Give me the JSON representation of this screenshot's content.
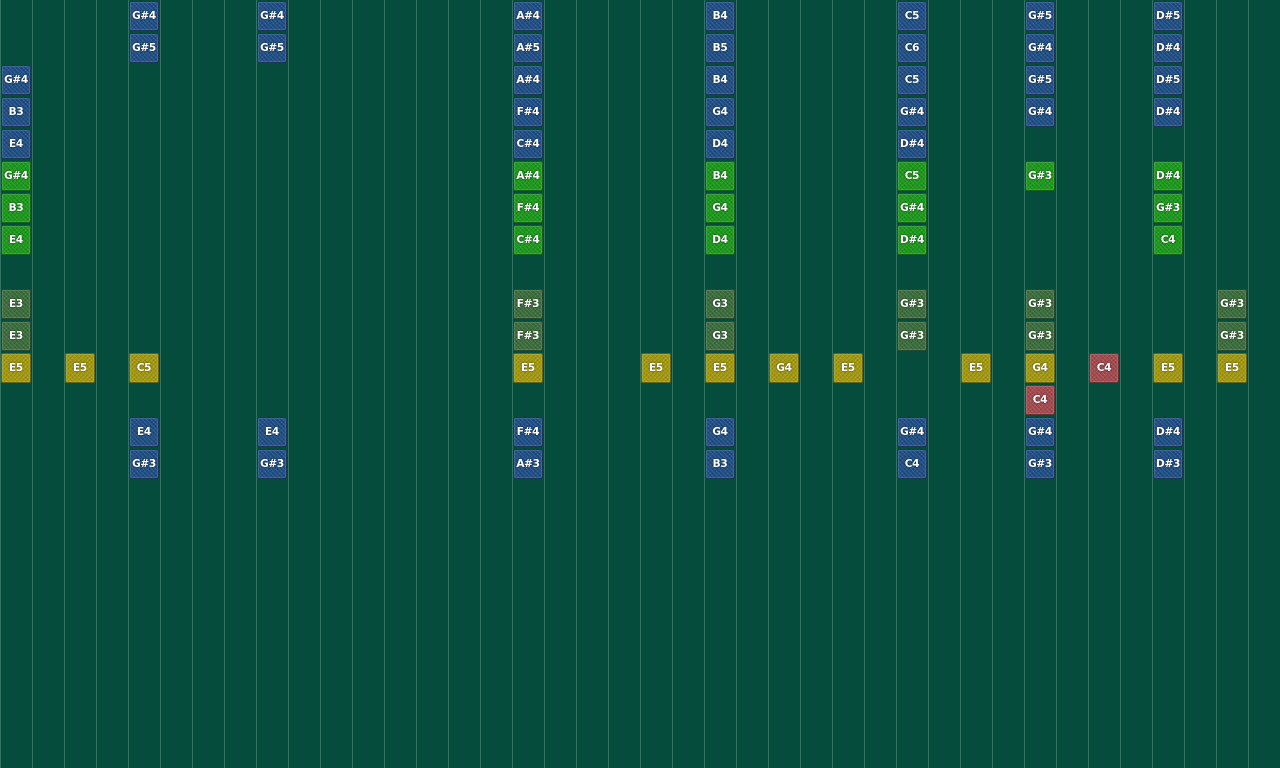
{
  "theme": {
    "background": "#064c3c",
    "grid_line": "#5a9682",
    "colors": {
      "blue": "#1f4f86",
      "green": "#1b9a1b",
      "olive": "#3b6d3c",
      "yellow": "#a49a10",
      "red": "#a54a4e"
    }
  },
  "grid": {
    "columns": 40,
    "rows": 24
  },
  "notes": [
    {
      "col": 4,
      "row": 0,
      "label": "G#4",
      "color": "blue"
    },
    {
      "col": 8,
      "row": 0,
      "label": "G#4",
      "color": "blue"
    },
    {
      "col": 16,
      "row": 0,
      "label": "A#4",
      "color": "blue"
    },
    {
      "col": 22,
      "row": 0,
      "label": "B4",
      "color": "blue"
    },
    {
      "col": 28,
      "row": 0,
      "label": "C5",
      "color": "blue"
    },
    {
      "col": 32,
      "row": 0,
      "label": "G#5",
      "color": "blue"
    },
    {
      "col": 36,
      "row": 0,
      "label": "D#5",
      "color": "blue"
    },
    {
      "col": 4,
      "row": 1,
      "label": "G#5",
      "color": "blue"
    },
    {
      "col": 8,
      "row": 1,
      "label": "G#5",
      "color": "blue"
    },
    {
      "col": 16,
      "row": 1,
      "label": "A#5",
      "color": "blue"
    },
    {
      "col": 22,
      "row": 1,
      "label": "B5",
      "color": "blue"
    },
    {
      "col": 28,
      "row": 1,
      "label": "C6",
      "color": "blue"
    },
    {
      "col": 32,
      "row": 1,
      "label": "G#4",
      "color": "blue"
    },
    {
      "col": 36,
      "row": 1,
      "label": "D#4",
      "color": "blue"
    },
    {
      "col": 0,
      "row": 2,
      "label": "G#4",
      "color": "blue"
    },
    {
      "col": 16,
      "row": 2,
      "label": "A#4",
      "color": "blue"
    },
    {
      "col": 22,
      "row": 2,
      "label": "B4",
      "color": "blue"
    },
    {
      "col": 28,
      "row": 2,
      "label": "C5",
      "color": "blue"
    },
    {
      "col": 32,
      "row": 2,
      "label": "G#5",
      "color": "blue"
    },
    {
      "col": 36,
      "row": 2,
      "label": "D#5",
      "color": "blue"
    },
    {
      "col": 0,
      "row": 3,
      "label": "B3",
      "color": "blue"
    },
    {
      "col": 16,
      "row": 3,
      "label": "F#4",
      "color": "blue"
    },
    {
      "col": 22,
      "row": 3,
      "label": "G4",
      "color": "blue"
    },
    {
      "col": 28,
      "row": 3,
      "label": "G#4",
      "color": "blue"
    },
    {
      "col": 32,
      "row": 3,
      "label": "G#4",
      "color": "blue"
    },
    {
      "col": 36,
      "row": 3,
      "label": "D#4",
      "color": "blue"
    },
    {
      "col": 0,
      "row": 4,
      "label": "E4",
      "color": "blue"
    },
    {
      "col": 16,
      "row": 4,
      "label": "C#4",
      "color": "blue"
    },
    {
      "col": 22,
      "row": 4,
      "label": "D4",
      "color": "blue"
    },
    {
      "col": 28,
      "row": 4,
      "label": "D#4",
      "color": "blue"
    },
    {
      "col": 0,
      "row": 5,
      "label": "G#4",
      "color": "green"
    },
    {
      "col": 16,
      "row": 5,
      "label": "A#4",
      "color": "green"
    },
    {
      "col": 22,
      "row": 5,
      "label": "B4",
      "color": "green"
    },
    {
      "col": 28,
      "row": 5,
      "label": "C5",
      "color": "green"
    },
    {
      "col": 32,
      "row": 5,
      "label": "G#3",
      "color": "green"
    },
    {
      "col": 36,
      "row": 5,
      "label": "D#4",
      "color": "green"
    },
    {
      "col": 0,
      "row": 6,
      "label": "B3",
      "color": "green"
    },
    {
      "col": 16,
      "row": 6,
      "label": "F#4",
      "color": "green"
    },
    {
      "col": 22,
      "row": 6,
      "label": "G4",
      "color": "green"
    },
    {
      "col": 28,
      "row": 6,
      "label": "G#4",
      "color": "green"
    },
    {
      "col": 36,
      "row": 6,
      "label": "G#3",
      "color": "green"
    },
    {
      "col": 0,
      "row": 7,
      "label": "E4",
      "color": "green"
    },
    {
      "col": 16,
      "row": 7,
      "label": "C#4",
      "color": "green"
    },
    {
      "col": 22,
      "row": 7,
      "label": "D4",
      "color": "green"
    },
    {
      "col": 28,
      "row": 7,
      "label": "D#4",
      "color": "green"
    },
    {
      "col": 36,
      "row": 7,
      "label": "C4",
      "color": "green"
    },
    {
      "col": 0,
      "row": 9,
      "label": "E3",
      "color": "olive"
    },
    {
      "col": 16,
      "row": 9,
      "label": "F#3",
      "color": "olive"
    },
    {
      "col": 22,
      "row": 9,
      "label": "G3",
      "color": "olive"
    },
    {
      "col": 28,
      "row": 9,
      "label": "G#3",
      "color": "olive"
    },
    {
      "col": 32,
      "row": 9,
      "label": "G#3",
      "color": "olive"
    },
    {
      "col": 38,
      "row": 9,
      "label": "G#3",
      "color": "olive"
    },
    {
      "col": 0,
      "row": 10,
      "label": "E3",
      "color": "olive"
    },
    {
      "col": 16,
      "row": 10,
      "label": "F#3",
      "color": "olive"
    },
    {
      "col": 22,
      "row": 10,
      "label": "G3",
      "color": "olive"
    },
    {
      "col": 28,
      "row": 10,
      "label": "G#3",
      "color": "olive"
    },
    {
      "col": 32,
      "row": 10,
      "label": "G#3",
      "color": "olive"
    },
    {
      "col": 38,
      "row": 10,
      "label": "G#3",
      "color": "olive"
    },
    {
      "col": 0,
      "row": 11,
      "label": "E5",
      "color": "yellow"
    },
    {
      "col": 2,
      "row": 11,
      "label": "E5",
      "color": "yellow"
    },
    {
      "col": 4,
      "row": 11,
      "label": "C5",
      "color": "yellow"
    },
    {
      "col": 16,
      "row": 11,
      "label": "E5",
      "color": "yellow"
    },
    {
      "col": 20,
      "row": 11,
      "label": "E5",
      "color": "yellow"
    },
    {
      "col": 22,
      "row": 11,
      "label": "E5",
      "color": "yellow"
    },
    {
      "col": 24,
      "row": 11,
      "label": "G4",
      "color": "yellow"
    },
    {
      "col": 26,
      "row": 11,
      "label": "E5",
      "color": "yellow"
    },
    {
      "col": 30,
      "row": 11,
      "label": "E5",
      "color": "yellow"
    },
    {
      "col": 32,
      "row": 11,
      "label": "G4",
      "color": "yellow"
    },
    {
      "col": 34,
      "row": 11,
      "label": "C4",
      "color": "red"
    },
    {
      "col": 36,
      "row": 11,
      "label": "E5",
      "color": "yellow"
    },
    {
      "col": 38,
      "row": 11,
      "label": "E5",
      "color": "yellow"
    },
    {
      "col": 32,
      "row": 12,
      "label": "C4",
      "color": "red"
    },
    {
      "col": 4,
      "row": 13,
      "label": "E4",
      "color": "blue"
    },
    {
      "col": 8,
      "row": 13,
      "label": "E4",
      "color": "blue"
    },
    {
      "col": 16,
      "row": 13,
      "label": "F#4",
      "color": "blue"
    },
    {
      "col": 22,
      "row": 13,
      "label": "G4",
      "color": "blue"
    },
    {
      "col": 28,
      "row": 13,
      "label": "G#4",
      "color": "blue"
    },
    {
      "col": 32,
      "row": 13,
      "label": "G#4",
      "color": "blue"
    },
    {
      "col": 36,
      "row": 13,
      "label": "D#4",
      "color": "blue"
    },
    {
      "col": 4,
      "row": 14,
      "label": "G#3",
      "color": "blue"
    },
    {
      "col": 8,
      "row": 14,
      "label": "G#3",
      "color": "blue"
    },
    {
      "col": 16,
      "row": 14,
      "label": "A#3",
      "color": "blue"
    },
    {
      "col": 22,
      "row": 14,
      "label": "B3",
      "color": "blue"
    },
    {
      "col": 28,
      "row": 14,
      "label": "C4",
      "color": "blue"
    },
    {
      "col": 32,
      "row": 14,
      "label": "G#3",
      "color": "blue"
    },
    {
      "col": 36,
      "row": 14,
      "label": "D#3",
      "color": "blue"
    }
  ]
}
